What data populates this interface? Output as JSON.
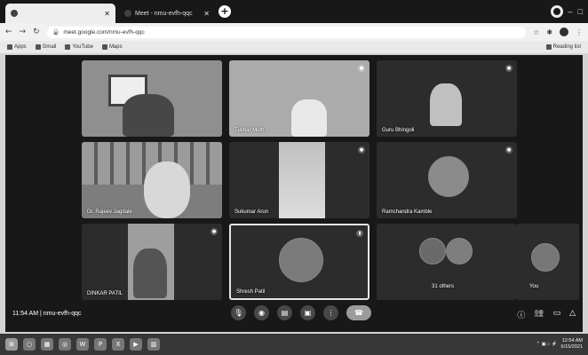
{
  "browser": {
    "tabs": [
      {
        "title": "",
        "active": true
      },
      {
        "title": "Meet - nmu-evfh-qqc",
        "active": false
      }
    ],
    "new_tab_label": "+",
    "url": "meet.google.com/nmu-evfh-qqc",
    "bookmarks": [
      {
        "label": "Apps",
        "icon": "apps-icon"
      },
      {
        "label": "Gmail",
        "icon": "gmail-icon"
      },
      {
        "label": "YouTube",
        "icon": "youtube-icon"
      },
      {
        "label": "Maps",
        "icon": "maps-icon"
      }
    ],
    "reading_list": "Reading list"
  },
  "meet": {
    "participants": [
      {
        "name": ""
      },
      {
        "name": "Tushar Muth"
      },
      {
        "name": "Guru Bhingoli"
      },
      {
        "name": "Dr. Rajeev Jagdale"
      },
      {
        "name": "Sukumar Arun"
      },
      {
        "name": "Ramchandra Kamble"
      },
      {
        "name": "DINKAR PATIL"
      },
      {
        "name": "Shresh Patil"
      },
      {
        "name": "31 others"
      },
      {
        "name": "You"
      }
    ],
    "time_code": "11:54 AM | nmu-evfh-qqc",
    "controls": [
      "mic-icon",
      "camera-icon",
      "captions-icon",
      "present-icon",
      "more-icon",
      "end-call-icon"
    ],
    "right_controls": [
      "info-icon",
      "people-icon",
      "chat-icon",
      "activities-icon"
    ]
  },
  "taskbar": {
    "apps": [
      "start-icon",
      "search-icon",
      "file-explorer-icon",
      "chrome-icon",
      "word-icon",
      "powerpoint-icon",
      "excel-icon",
      "media-icon",
      "folder-icon"
    ],
    "time": "12:54 AM",
    "date": "6/15/2021"
  }
}
